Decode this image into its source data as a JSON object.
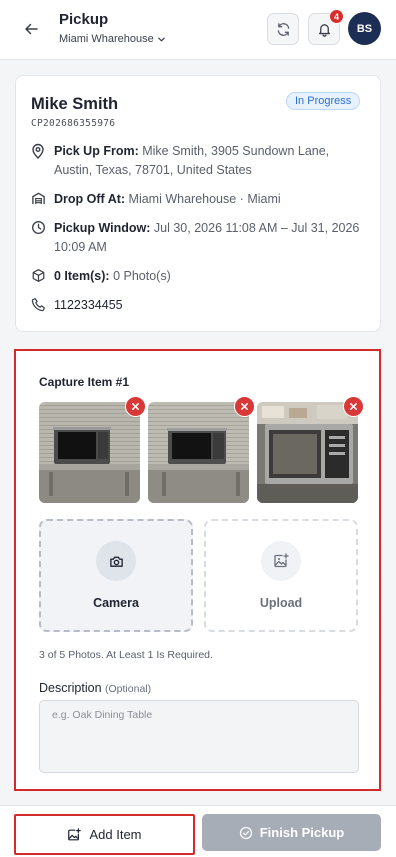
{
  "header": {
    "title": "Pickup",
    "warehouse": "Miami Wharehouse",
    "notification_count": "4",
    "avatar_initials": "BS"
  },
  "info": {
    "customer_name": "Mike Smith",
    "order_id": "CP202686355976",
    "status": "In Progress",
    "pickup_label": "Pick Up From:",
    "pickup_value": "Mike Smith, 3905 Sundown Lane, Austin, Texas, 78701, United States",
    "dropoff_label": "Drop Off At:",
    "dropoff_value": "Miami Wharehouse · Miami",
    "window_label": "Pickup Window:",
    "window_value": "Jul 30, 2026 11:08 AM – Jul 31, 2026 10:09 AM",
    "items_label": "0 Item(s):",
    "items_value": "0 Photo(s)",
    "phone": "1122334455"
  },
  "capture": {
    "title": "Capture Item #1",
    "camera_label": "Camera",
    "upload_label": "Upload",
    "photo_hint": "3 of 5 Photos. At Least 1 Is Required.",
    "description_label": "Description",
    "description_optional": "(Optional)",
    "description_placeholder": "e.g. Oak Dining Table",
    "description_value": ""
  },
  "footer": {
    "add_item_label": "Add Item",
    "finish_label": "Finish Pickup"
  },
  "colors": {
    "status_blue": "#2a6fd6",
    "danger_red": "#d93838",
    "avatar_navy": "#1d2e55",
    "disabled_grey": "#a7adb6"
  }
}
